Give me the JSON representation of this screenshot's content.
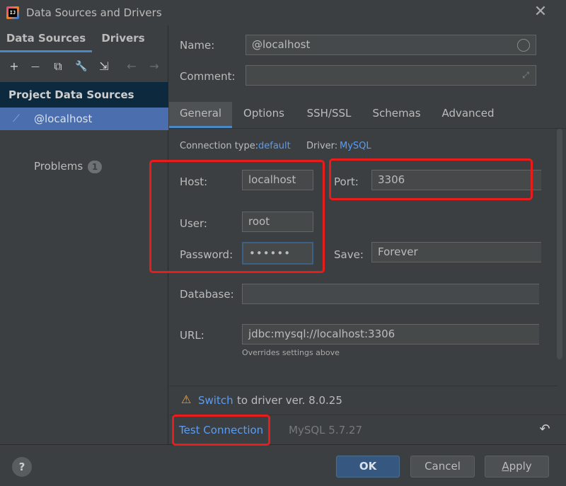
{
  "window": {
    "title": "Data Sources and Drivers",
    "logo_text": "IJ",
    "close_glyph": "✕"
  },
  "left": {
    "tabs": [
      {
        "label": "Data Sources"
      },
      {
        "label": "Drivers"
      }
    ],
    "toolbar": {
      "add": "+",
      "remove": "—",
      "duplicate": "⧉",
      "settings": "🔧",
      "import": "⇲",
      "back": "←",
      "forward": "→"
    },
    "section_header": "Project Data Sources",
    "data_source": {
      "label": "@localhost",
      "icon": "⟋"
    },
    "problems": {
      "label": "Problems",
      "count": "1"
    }
  },
  "right": {
    "name": {
      "label": "Name:",
      "value": "@localhost"
    },
    "comment": {
      "label": "Comment:",
      "value": ""
    },
    "tabs": [
      {
        "label": "General"
      },
      {
        "label": "Options"
      },
      {
        "label": "SSH/SSL"
      },
      {
        "label": "Schemas"
      },
      {
        "label": "Advanced"
      }
    ],
    "general": {
      "connection_type_label": "Connection type:",
      "connection_type_value": "default",
      "driver_label": "Driver:",
      "driver_value": "MySQL",
      "host_label": "Host:",
      "host_value": "localhost",
      "port_label": "Port:",
      "port_value": "3306",
      "user_label": "User:",
      "user_value": "root",
      "password_label": "Password:",
      "password_value": "••••••",
      "save_label": "Save:",
      "save_value": "Forever",
      "database_label": "Database:",
      "database_value": "",
      "url_label": "URL:",
      "url_value": "jdbc:mysql://localhost:3306",
      "url_hint": "Overrides settings above"
    },
    "warning": {
      "icon": "⚠",
      "link": "Switch",
      "text": "to driver ver. 8.0.25"
    },
    "test_connection": "Test Connection",
    "server_version": "MySQL 5.7.27",
    "revert_icon": "↶"
  },
  "footer": {
    "help": "?",
    "ok": "OK",
    "cancel": "Cancel",
    "apply_first": "A",
    "apply_rest": "pply"
  },
  "colors": {
    "accent": "#4a88c7",
    "link": "#589df6",
    "highlight": "#ea1b1b",
    "selection": "#4b6eaf"
  }
}
